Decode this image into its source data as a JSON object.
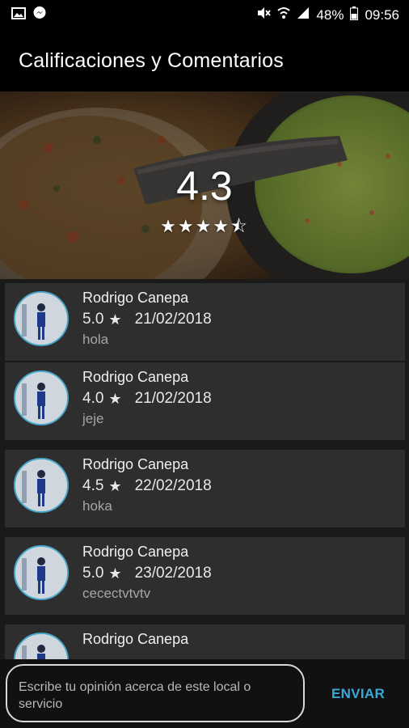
{
  "status_bar": {
    "battery": "48%",
    "time": "09:56"
  },
  "app_bar": {
    "title": "Calificaciones y Comentarios"
  },
  "header": {
    "rating": "4.3",
    "stars": "★★★★⯪"
  },
  "reviews": [
    {
      "name": "Rodrigo Canepa",
      "score": "5.0",
      "date": "21/02/2018",
      "comment": "hola"
    },
    {
      "name": "Rodrigo Canepa",
      "score": "4.0",
      "date": "21/02/2018",
      "comment": "jeje"
    },
    {
      "name": "Rodrigo Canepa",
      "score": "4.5",
      "date": "22/02/2018",
      "comment": "hoka"
    },
    {
      "name": "Rodrigo Canepa",
      "score": "5.0",
      "date": "23/02/2018",
      "comment": "cecectvtvtv"
    },
    {
      "name": "Rodrigo Canepa",
      "score": "",
      "date": "",
      "comment": ""
    }
  ],
  "composer": {
    "placeholder": "Escribe tu opinión acerca de este local o servicio",
    "send_label": "ENVIAR"
  },
  "colors": {
    "accent": "#3aa8d8",
    "card": "#2e2e2e",
    "avatar_ring": "#48a6c9"
  }
}
